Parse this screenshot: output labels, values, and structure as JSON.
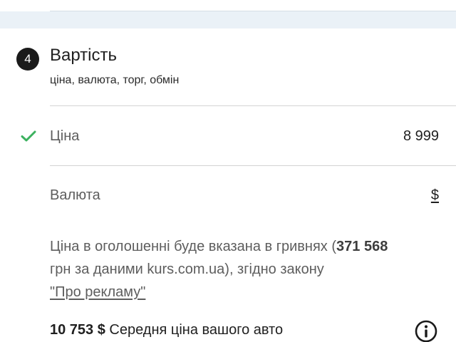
{
  "section": {
    "step_number": "4",
    "title": "Вартість",
    "subtitle": "ціна, валюта, торг, обмін"
  },
  "price": {
    "label": "Ціна",
    "value": "8 999"
  },
  "currency": {
    "label": "Валюта",
    "value": "$"
  },
  "note": {
    "text_before": "Ціна в оголошенні буде вказана в гривнях (",
    "uah_amount": "371 568",
    "text_after": "грн за даними kurs.com.ua), згідно закону",
    "law_link": "\"Про рекламу\""
  },
  "average": {
    "amount": "10 753 $",
    "label": "Середня ціна вашого авто"
  },
  "icons": {
    "check": "check-icon",
    "info": "info-icon"
  },
  "colors": {
    "check_green": "#3cb15f",
    "badge_bg": "#1a1a1a",
    "top_band": "#eaf1f7"
  }
}
